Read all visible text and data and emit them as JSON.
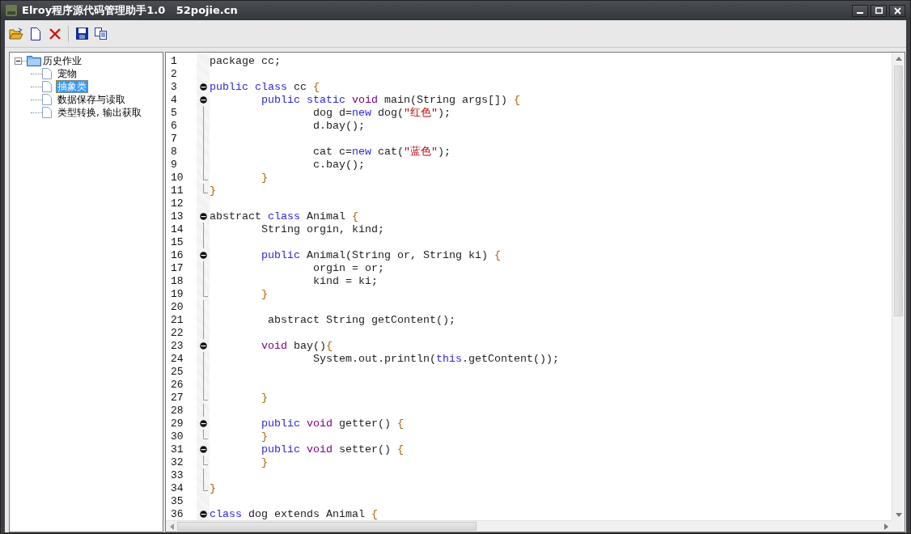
{
  "window": {
    "title": "Elroy程序源代码管理助手1.0   52pojie.cn"
  },
  "tree": [
    {
      "label": "历史作业",
      "expanded": true,
      "selected": false,
      "children": [
        {
          "label": "宠物",
          "selected": false
        },
        {
          "label": "抽象类",
          "selected": true
        },
        {
          "label": "数据保存与读取",
          "selected": false
        },
        {
          "label": "类型转换, 输出获取",
          "selected": false
        }
      ]
    }
  ],
  "editor": {
    "lines": [
      {
        "number": "1",
        "kind": "plain",
        "tokens": [
          {
            "kind": "text",
            "text": "package cc;"
          }
        ]
      },
      {
        "number": "2",
        "kind": "plain"
      },
      {
        "number": "3",
        "kind": "fold_start",
        "tokens": [
          {
            "kind": "keyword",
            "text": "public class"
          },
          {
            "kind": "text",
            "text": " cc "
          },
          {
            "kind": "brace",
            "text": "{"
          }
        ]
      },
      {
        "number": "4",
        "kind": "fold_start",
        "tokens": [
          {
            "kind": "keyword",
            "text": "        public static"
          },
          {
            "kind": "type",
            "text": " void"
          },
          {
            "kind": "text",
            "text": " main(String args[]) "
          },
          {
            "kind": "brace",
            "text": "{"
          }
        ]
      },
      {
        "number": "5",
        "kind": "fold_body",
        "tokens": [
          {
            "kind": "text",
            "text": "                dog d="
          },
          {
            "kind": "keyword",
            "text": "new"
          },
          {
            "kind": "text",
            "text": " dog("
          },
          {
            "kind": "string",
            "text": "\"红色\""
          },
          {
            "kind": "text",
            "text": ");"
          }
        ]
      },
      {
        "number": "6",
        "kind": "fold_body",
        "tokens": [
          {
            "kind": "text",
            "text": "                d.bay();"
          }
        ]
      },
      {
        "number": "7",
        "kind": "fold_body"
      },
      {
        "number": "8",
        "kind": "fold_body",
        "tokens": [
          {
            "kind": "text",
            "text": "                cat c="
          },
          {
            "kind": "keyword",
            "text": "new"
          },
          {
            "kind": "text",
            "text": " cat("
          },
          {
            "kind": "string",
            "text": "\"蓝色\""
          },
          {
            "kind": "text",
            "text": ");"
          }
        ]
      },
      {
        "number": "9",
        "kind": "fold_body",
        "tokens": [
          {
            "kind": "text",
            "text": "                c.bay();"
          }
        ]
      },
      {
        "number": "10",
        "kind": "fold_end",
        "tokens": [
          {
            "kind": "brace",
            "text": "        }"
          }
        ]
      },
      {
        "number": "11",
        "kind": "fold_end",
        "tokens": [
          {
            "kind": "brace",
            "text": "}"
          }
        ]
      },
      {
        "number": "12",
        "kind": "plain"
      },
      {
        "number": "13",
        "kind": "fold_start",
        "tokens": [
          {
            "kind": "text",
            "text": "abstract "
          },
          {
            "kind": "keyword",
            "text": "class"
          },
          {
            "kind": "text",
            "text": " Animal "
          },
          {
            "kind": "brace",
            "text": "{"
          }
        ]
      },
      {
        "number": "14",
        "kind": "fold_body",
        "tokens": [
          {
            "kind": "text",
            "text": "        String orgin, kind;"
          }
        ]
      },
      {
        "number": "15",
        "kind": "fold_body"
      },
      {
        "number": "16",
        "kind": "fold_start",
        "tokens": [
          {
            "kind": "keyword",
            "text": "        public"
          },
          {
            "kind": "text",
            "text": " Animal(String or, String ki) "
          },
          {
            "kind": "brace",
            "text": "{"
          }
        ]
      },
      {
        "number": "17",
        "kind": "fold_body",
        "tokens": [
          {
            "kind": "text",
            "text": "                orgin = or;"
          }
        ]
      },
      {
        "number": "18",
        "kind": "fold_body",
        "tokens": [
          {
            "kind": "text",
            "text": "                kind = ki;"
          }
        ]
      },
      {
        "number": "19",
        "kind": "fold_end",
        "tokens": [
          {
            "kind": "brace",
            "text": "        }"
          }
        ]
      },
      {
        "number": "20",
        "kind": "fold_body"
      },
      {
        "number": "21",
        "kind": "fold_body",
        "tokens": [
          {
            "kind": "text",
            "text": "         abstract String getContent();"
          }
        ]
      },
      {
        "number": "22",
        "kind": "fold_body"
      },
      {
        "number": "23",
        "kind": "fold_start",
        "tokens": [
          {
            "kind": "type",
            "text": "        void"
          },
          {
            "kind": "text",
            "text": " bay()"
          },
          {
            "kind": "brace",
            "text": "{"
          }
        ]
      },
      {
        "number": "24",
        "kind": "fold_body",
        "tokens": [
          {
            "kind": "text",
            "text": "                System.out.println("
          },
          {
            "kind": "keyword",
            "text": "this"
          },
          {
            "kind": "text",
            "text": ".getContent());"
          }
        ]
      },
      {
        "number": "25",
        "kind": "fold_body"
      },
      {
        "number": "26",
        "kind": "fold_body"
      },
      {
        "number": "27",
        "kind": "fold_end",
        "tokens": [
          {
            "kind": "brace",
            "text": "        }"
          }
        ]
      },
      {
        "number": "28",
        "kind": "fold_body"
      },
      {
        "number": "29",
        "kind": "fold_start",
        "tokens": [
          {
            "kind": "keyword",
            "text": "        public"
          },
          {
            "kind": "type",
            "text": " void"
          },
          {
            "kind": "text",
            "text": " getter() "
          },
          {
            "kind": "brace",
            "text": "{"
          }
        ]
      },
      {
        "number": "30",
        "kind": "fold_end",
        "tokens": [
          {
            "kind": "brace",
            "text": "        }"
          }
        ]
      },
      {
        "number": "31",
        "kind": "fold_start",
        "tokens": [
          {
            "kind": "keyword",
            "text": "        public"
          },
          {
            "kind": "type",
            "text": " void"
          },
          {
            "kind": "text",
            "text": " setter() "
          },
          {
            "kind": "brace",
            "text": "{"
          }
        ]
      },
      {
        "number": "32",
        "kind": "fold_end",
        "tokens": [
          {
            "kind": "brace",
            "text": "        }"
          }
        ]
      },
      {
        "number": "33",
        "kind": "fold_body"
      },
      {
        "number": "34",
        "kind": "fold_end",
        "tokens": [
          {
            "kind": "brace",
            "text": "}"
          }
        ]
      },
      {
        "number": "35",
        "kind": "plain"
      },
      {
        "number": "36",
        "kind": "fold_start",
        "tokens": [
          {
            "kind": "keyword",
            "text": "class"
          },
          {
            "kind": "text",
            "text": " dog extends Animal "
          },
          {
            "kind": "brace",
            "text": "{"
          }
        ]
      }
    ]
  }
}
